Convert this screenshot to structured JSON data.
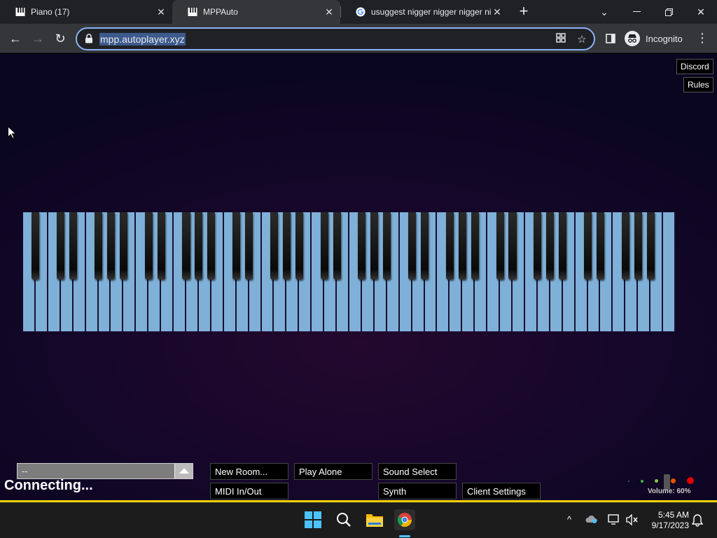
{
  "browser": {
    "tabs": [
      {
        "title": "Piano (17)"
      },
      {
        "title": "MPPAuto"
      },
      {
        "title": "usuggest nigger nigger nigger ni"
      }
    ],
    "url": "mpp.autoplayer.xyz",
    "profile_label": "Incognito"
  },
  "page": {
    "top_buttons": {
      "discord": "Discord",
      "rules": "Rules"
    },
    "room_select_value": "--",
    "status": "Connecting...",
    "buttons": {
      "new_room": "New Room...",
      "play_alone": "Play Alone",
      "sound_select": "Sound Select",
      "midi": "MIDI In/Out",
      "synth": "Synth",
      "client_settings": "Client Settings"
    },
    "volume_label": "Volume: 60%",
    "volume_value": 60,
    "piano": {
      "white_keys": 52,
      "key_color": "#7fb0d8"
    }
  },
  "taskbar": {
    "time": "5:45 AM",
    "date": "9/17/2023"
  },
  "colors": {
    "accent": "#8ab4f8",
    "status_bar": "#f0d000"
  }
}
